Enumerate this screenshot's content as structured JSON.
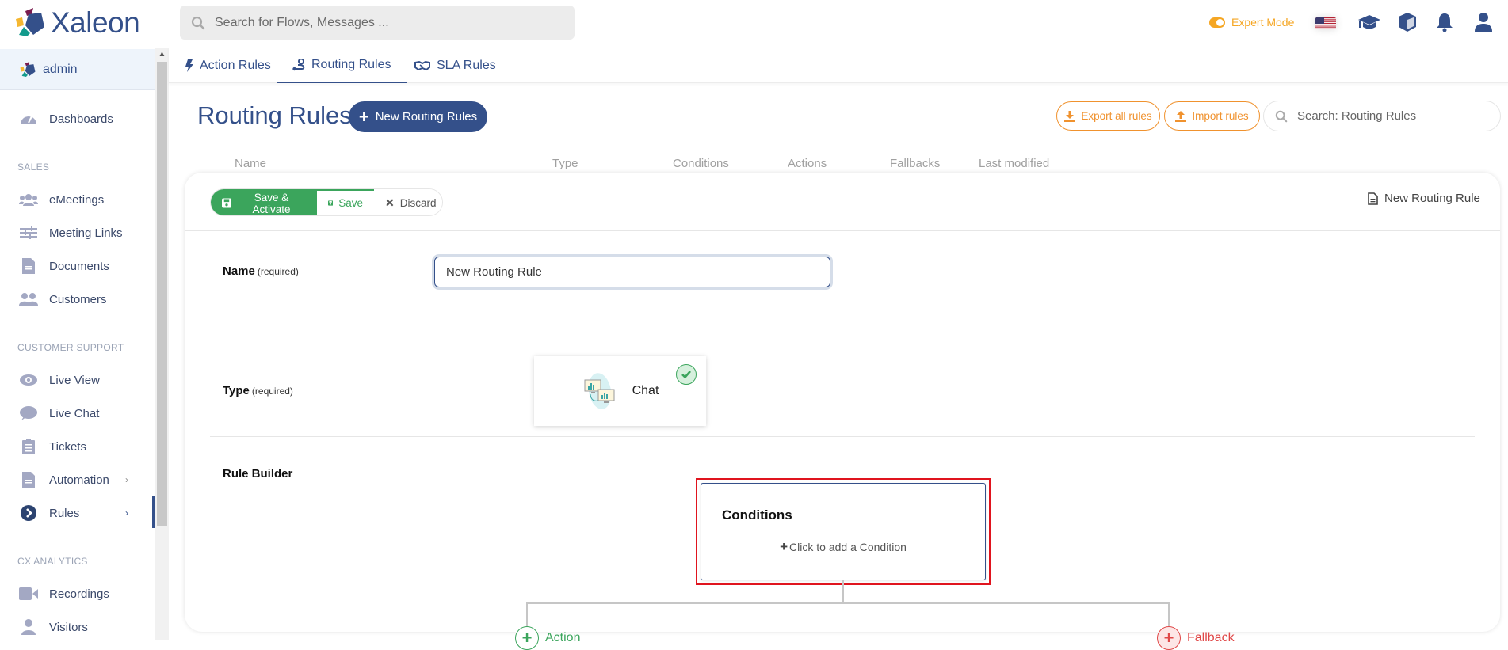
{
  "app": {
    "brand": "Xaleon"
  },
  "header": {
    "search_placeholder": "Search for Flows, Messages ...",
    "expert_mode_label": "Expert Mode",
    "expert_mode_on": true,
    "icons": [
      "us-flag-icon",
      "graduation-cap-icon",
      "cube-icon",
      "bell-icon",
      "user-icon"
    ]
  },
  "sidebar": {
    "user": "admin",
    "items": [
      {
        "label": "Dashboards",
        "icon": "dashboard-gauge-icon"
      },
      {
        "section": "SALES"
      },
      {
        "label": "eMeetings",
        "icon": "users-group-icon"
      },
      {
        "label": "Meeting Links",
        "icon": "sliders-icon"
      },
      {
        "label": "Documents",
        "icon": "document-icon"
      },
      {
        "label": "Customers",
        "icon": "customers-icon"
      },
      {
        "section": "CUSTOMER SUPPORT"
      },
      {
        "label": "Live View",
        "icon": "eye-icon"
      },
      {
        "label": "Live Chat",
        "icon": "chat-bubble-icon"
      },
      {
        "label": "Tickets",
        "icon": "clipboard-list-icon"
      },
      {
        "label": "Automation",
        "icon": "document-icon",
        "chevron": "›"
      },
      {
        "label": "Rules",
        "icon": "chevron-circle-right-icon",
        "chevron": "›",
        "active": true
      },
      {
        "section": "CX ANALYTICS"
      },
      {
        "label": "Recordings",
        "icon": "video-camera-icon"
      },
      {
        "label": "Visitors",
        "icon": "user-icon"
      }
    ]
  },
  "tabs": [
    {
      "label": "Action Rules",
      "icon": "bolt-icon"
    },
    {
      "label": "Routing Rules",
      "icon": "route-icon",
      "active": true
    },
    {
      "label": "SLA Rules",
      "icon": "handshake-icon"
    }
  ],
  "page": {
    "title": "Routing Rules",
    "new_button": "New Routing Rules",
    "export_button": "Export all rules",
    "import_button": "Import rules",
    "search_placeholder": "Search: Routing Rules",
    "columns": [
      "Name",
      "Type",
      "Conditions",
      "Actions",
      "Fallbacks",
      "Last modified"
    ]
  },
  "editor": {
    "save_activate": "Save & Activate",
    "save": "Save",
    "discard": "Discard",
    "doc_tab": "New Routing Rule",
    "name_label": "Name",
    "type_label": "Type",
    "required": "(required)",
    "name_value": "New Routing Rule",
    "type_option": {
      "label": "Chat",
      "selected": true
    },
    "rule_builder_label": "Rule Builder",
    "conditions_title": "Conditions",
    "conditions_add": "Click to add a Condition",
    "action_label": "Action",
    "fallback_label": "Fallback"
  },
  "colors": {
    "brand": "#34508a",
    "success": "#3ba55c",
    "warning": "#f0922e",
    "danger": "#e04848",
    "highlight": "#e0141e"
  }
}
